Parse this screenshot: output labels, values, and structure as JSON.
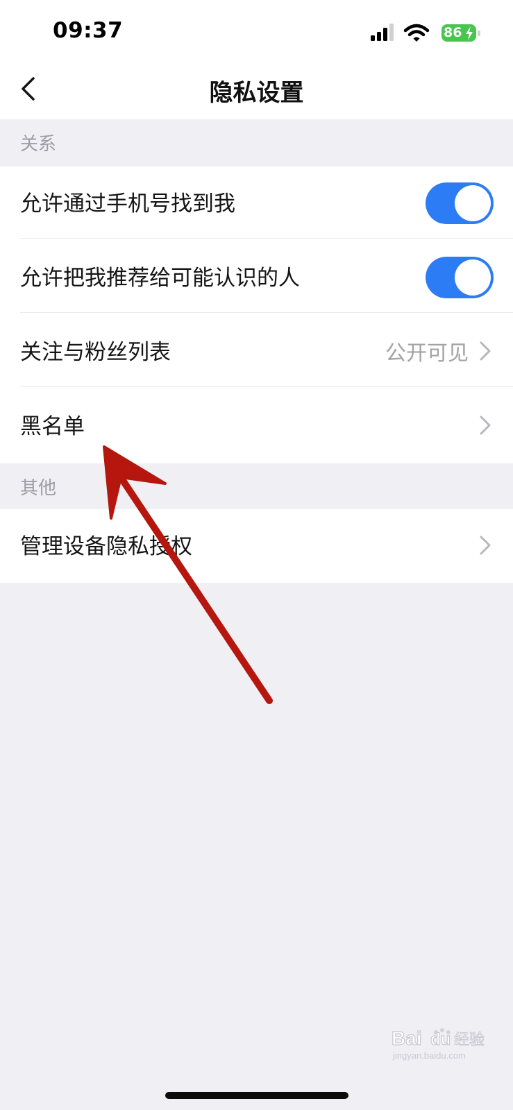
{
  "status_bar": {
    "time": "09:37",
    "battery": "86"
  },
  "nav": {
    "title": "隐私设置",
    "back_icon": "chevron-left-icon"
  },
  "sections": {
    "relations": {
      "header": "关系",
      "rows": [
        {
          "label": "允许通过手机号找到我",
          "control": "toggle",
          "enabled": true
        },
        {
          "label": "允许把我推荐给可能认识的人",
          "control": "toggle",
          "enabled": true
        },
        {
          "label": "关注与粉丝列表",
          "value": "公开可见",
          "control": "chevron"
        },
        {
          "label": "黑名单",
          "control": "chevron"
        }
      ]
    },
    "others": {
      "header": "其他",
      "rows": [
        {
          "label": "管理设备隐私授权",
          "control": "chevron"
        }
      ]
    }
  },
  "colors": {
    "toggle_on": "#2c7cf5",
    "annotation_arrow": "#b5160e",
    "battery": "#47c54e",
    "background": "#efeff4"
  },
  "watermark": {
    "brand": "Baidu经验",
    "url": "jingyan.baidu.com"
  }
}
